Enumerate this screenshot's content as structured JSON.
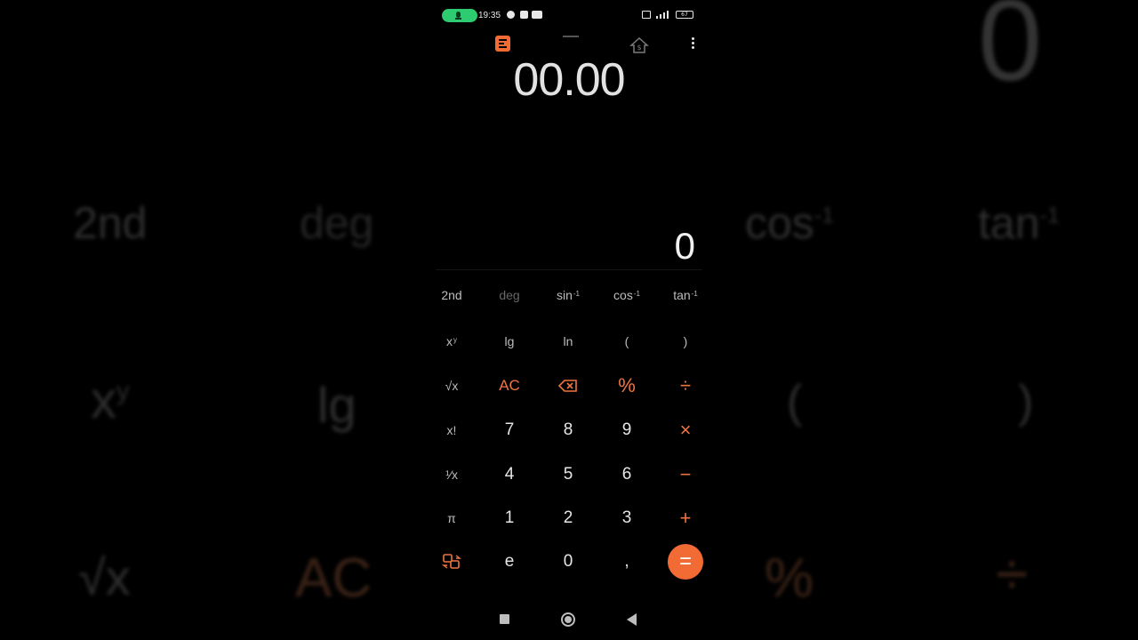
{
  "status_bar": {
    "time": "19:35",
    "battery": "67"
  },
  "display": {
    "expression": "00.00",
    "result": "0"
  },
  "keypad": {
    "second": "2nd",
    "deg": "deg",
    "sin": "sin",
    "cos": "cos",
    "tan": "tan",
    "inverse_sup": "-1",
    "power_base": "x",
    "power_sup": "y",
    "lg": "lg",
    "ln": "ln",
    "lparen": "(",
    "rparen": ")",
    "sqrt": "√x",
    "ac": "AC",
    "percent": "%",
    "divide": "÷",
    "factorial": "x!",
    "multiply": "×",
    "reciprocal": "¹⁄x",
    "minus": "−",
    "pi": "π",
    "plus": "+",
    "e": "e",
    "comma": ",",
    "equals": "=",
    "d7": "7",
    "d8": "8",
    "d9": "9",
    "d4": "4",
    "d5": "5",
    "d6": "6",
    "d1": "1",
    "d2": "2",
    "d3": "3",
    "d0": "0"
  },
  "colors": {
    "accent": "#f26a34",
    "mic_pill": "#2ecc71",
    "background": "#000000"
  },
  "icons": {
    "toolbar": [
      "calculator-icon",
      "converter-icon",
      "currency-icon",
      "more-icon"
    ],
    "nav": [
      "recents-icon",
      "home-icon",
      "back-icon"
    ]
  }
}
